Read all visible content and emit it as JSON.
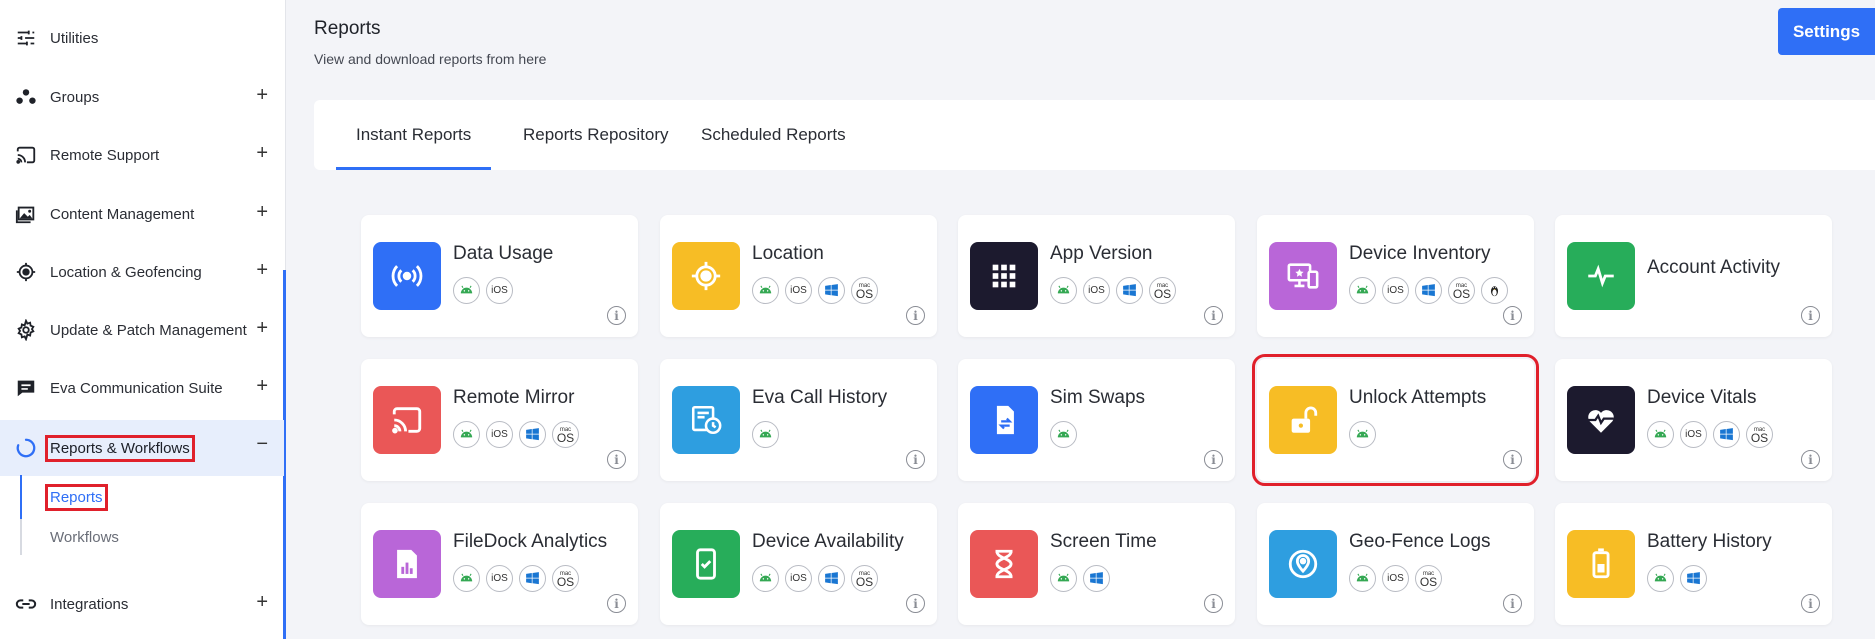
{
  "sidebar": {
    "items": [
      {
        "label": "Utilities",
        "icon": "sliders-icon",
        "toggle": ""
      },
      {
        "label": "Groups",
        "icon": "groups-icon",
        "toggle": "+"
      },
      {
        "label": "Remote Support",
        "icon": "cast-icon",
        "toggle": "+"
      },
      {
        "label": "Content Management",
        "icon": "images-icon",
        "toggle": "+"
      },
      {
        "label": "Location & Geofencing",
        "icon": "crosshair-icon",
        "toggle": "+"
      },
      {
        "label": "Update & Patch Management",
        "icon": "gear-icon",
        "toggle": "+"
      },
      {
        "label": "Eva Communication Suite",
        "icon": "chat-icon",
        "toggle": "+"
      },
      {
        "label": "Reports & Workflows",
        "icon": "reports-spinner-icon",
        "toggle": "−"
      },
      {
        "label": "Integrations",
        "icon": "link-icon",
        "toggle": "+"
      }
    ],
    "sub_items": [
      {
        "label": "Reports"
      },
      {
        "label": "Workflows"
      }
    ]
  },
  "header": {
    "title": "Reports",
    "subtitle": "View and download reports from here",
    "settings_label": "Settings"
  },
  "tabs": [
    {
      "label": "Instant Reports",
      "selected": true
    },
    {
      "label": "Reports Repository",
      "selected": false
    },
    {
      "label": "Scheduled Reports",
      "selected": false
    }
  ],
  "os_labels": {
    "ios": "iOS",
    "mac_top": "mac",
    "mac_bottom": "OS"
  },
  "info_glyph": "i",
  "reports": [
    {
      "title": "Data Usage",
      "color": "#2f6ff6",
      "icon": "signal-icon",
      "os": [
        "android",
        "ios"
      ]
    },
    {
      "title": "Location",
      "color": "#f7bd25",
      "icon": "location-target-icon",
      "os": [
        "android",
        "ios",
        "windows",
        "macos"
      ]
    },
    {
      "title": "App Version",
      "color": "#1c1a2e",
      "icon": "app-grid-icon",
      "os": [
        "android",
        "ios",
        "windows",
        "macos"
      ]
    },
    {
      "title": "Device Inventory",
      "color": "#b966d8",
      "icon": "devices-icon",
      "os": [
        "android",
        "ios",
        "windows",
        "macos",
        "linux"
      ]
    },
    {
      "title": "Account Activity",
      "color": "#27ad5a",
      "icon": "pulse-icon",
      "os": []
    },
    {
      "title": "Remote Mirror",
      "color": "#ea5757",
      "icon": "cast-icon",
      "os": [
        "android",
        "ios",
        "windows",
        "macos"
      ]
    },
    {
      "title": "Eva Call History",
      "color": "#2e9ee0",
      "icon": "call-history-icon",
      "os": [
        "android"
      ]
    },
    {
      "title": "Sim Swaps",
      "color": "#2f6ff6",
      "icon": "sim-swap-icon",
      "os": [
        "android"
      ]
    },
    {
      "title": "Unlock Attempts",
      "color": "#f7bd25",
      "icon": "unlock-icon",
      "os": [
        "android"
      ],
      "highlighted": true
    },
    {
      "title": "Device Vitals",
      "color": "#1c1a2e",
      "icon": "heart-pulse-icon",
      "os": [
        "android",
        "ios",
        "windows",
        "macos"
      ]
    },
    {
      "title": "FileDock Analytics",
      "color": "#b966d8",
      "icon": "file-chart-icon",
      "os": [
        "android",
        "ios",
        "windows",
        "macos"
      ]
    },
    {
      "title": "Device Availability",
      "color": "#27ad5a",
      "icon": "phone-check-icon",
      "os": [
        "android",
        "ios",
        "windows",
        "macos"
      ]
    },
    {
      "title": "Screen Time",
      "color": "#ea5757",
      "icon": "hourglass-icon",
      "os": [
        "android",
        "windows"
      ]
    },
    {
      "title": "Geo-Fence Logs",
      "color": "#2e9ee0",
      "icon": "map-pin-icon",
      "os": [
        "android",
        "ios",
        "macos"
      ]
    },
    {
      "title": "Battery History",
      "color": "#f7bd25",
      "icon": "battery-icon",
      "os": [
        "android",
        "windows"
      ]
    }
  ]
}
